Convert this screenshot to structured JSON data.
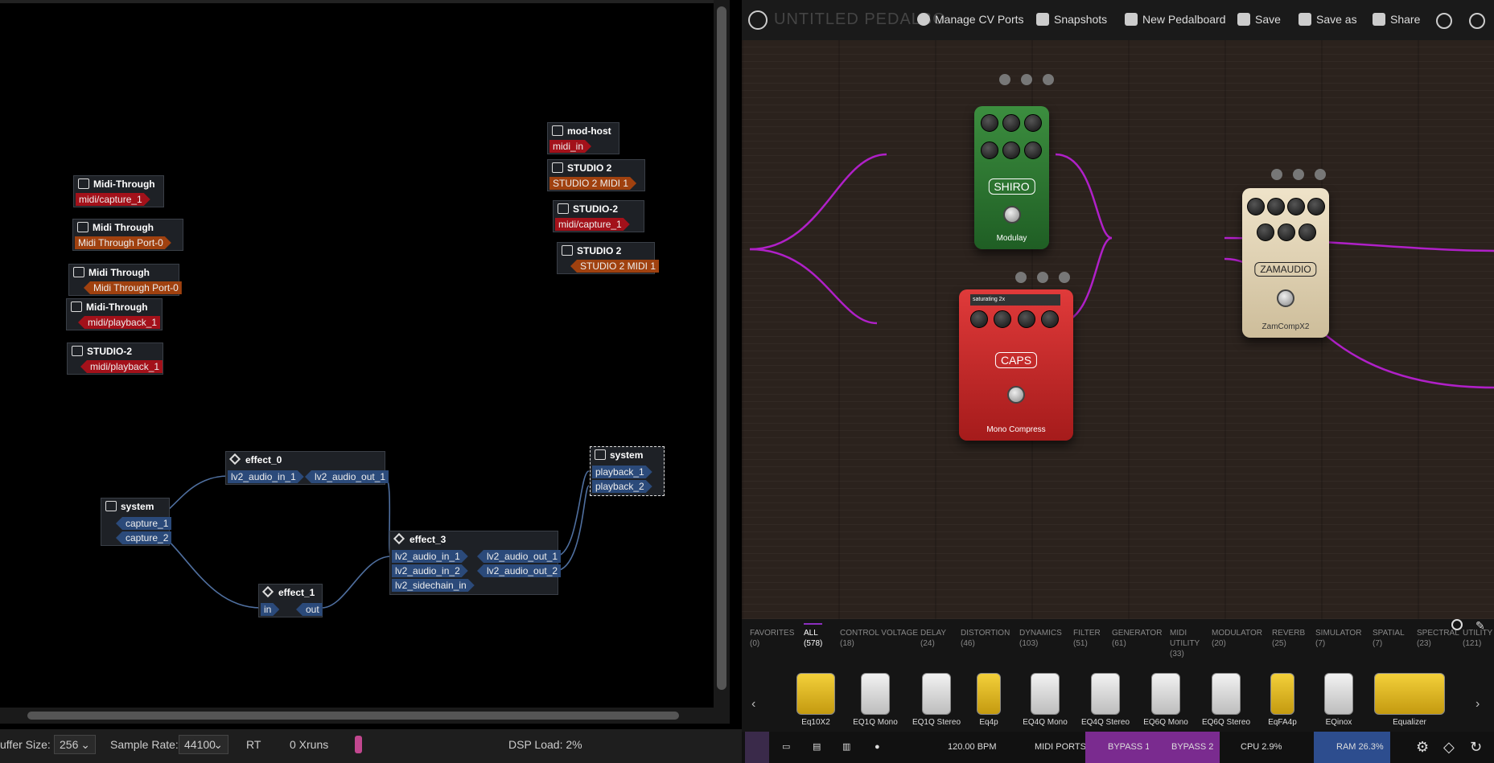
{
  "graph": {
    "nodes": {
      "midi_through_a": {
        "title": "Midi-Through",
        "ports": [
          "midi/capture_1"
        ]
      },
      "midi_through_b": {
        "title": "Midi Through",
        "ports": [
          "Midi Through Port-0"
        ]
      },
      "midi_through_c": {
        "title": "Midi Through",
        "ports": [
          "Midi Through Port-0"
        ]
      },
      "midi_through_d": {
        "title": "Midi-Through",
        "ports": [
          "midi/playback_1"
        ]
      },
      "studio2_a": {
        "title": "STUDIO-2",
        "ports": [
          "midi/playback_1"
        ]
      },
      "mod_host": {
        "title": "mod-host",
        "ports": [
          "midi_in"
        ]
      },
      "studio2_b": {
        "title": "STUDIO 2",
        "ports": [
          "STUDIO 2 MIDI 1"
        ]
      },
      "studio2_c": {
        "title": "STUDIO-2",
        "ports": [
          "midi/capture_1"
        ]
      },
      "studio2_d": {
        "title": "STUDIO 2",
        "ports": [
          "STUDIO 2 MIDI 1"
        ]
      },
      "system_capture": {
        "title": "system",
        "ports": [
          "capture_1",
          "capture_2"
        ]
      },
      "effect_0": {
        "title": "effect_0",
        "ports": [
          "lv2_audio_in_1",
          "lv2_audio_out_1"
        ]
      },
      "effect_1": {
        "title": "effect_1",
        "ports": [
          "in",
          "out"
        ]
      },
      "effect_3": {
        "title": "effect_3",
        "ports": [
          "lv2_audio_in_1",
          "lv2_audio_out_1",
          "lv2_audio_in_2",
          "lv2_audio_out_2",
          "lv2_sidechain_in"
        ]
      },
      "system_playback": {
        "title": "system",
        "ports": [
          "playback_1",
          "playback_2"
        ]
      }
    }
  },
  "statusbar": {
    "buffer_label": "uffer Size:",
    "buffer_value": "256",
    "rate_label": "Sample Rate:",
    "rate_value": "44100",
    "rt": "RT",
    "xruns": "0 Xruns",
    "dsp": "DSP Load: 2%"
  },
  "topbar": {
    "title": "UNTITLED PEDALBO",
    "manage_cv": "Manage CV Ports",
    "snapshots": "Snapshots",
    "new_pedalboard": "New Pedalboard",
    "save": "Save",
    "save_as": "Save as",
    "share": "Share"
  },
  "pedals": {
    "shiro": {
      "brand": "SHIRO",
      "name": "Modulay"
    },
    "caps": {
      "brand": "CAPS",
      "name": "Mono Compress",
      "display": "saturating 2x"
    },
    "zam": {
      "brand": "ZAMAUDIO",
      "name": "ZamCompX2"
    }
  },
  "categories": [
    {
      "label": "FAVORITES",
      "count": "(0)"
    },
    {
      "label": "ALL",
      "count": "(578)"
    },
    {
      "label": "CONTROL VOLTAGE",
      "count": "(18)"
    },
    {
      "label": "DELAY",
      "count": "(24)"
    },
    {
      "label": "DISTORTION",
      "count": "(46)"
    },
    {
      "label": "DYNAMICS",
      "count": "(103)"
    },
    {
      "label": "FILTER",
      "count": "(51)"
    },
    {
      "label": "GENERATOR",
      "count": "(61)"
    },
    {
      "label": "MIDI UTILITY",
      "count": "(33)"
    },
    {
      "label": "MODULATOR",
      "count": "(20)"
    },
    {
      "label": "REVERB",
      "count": "(25)"
    },
    {
      "label": "SIMULATOR",
      "count": "(7)"
    },
    {
      "label": "SPATIAL",
      "count": "(7)"
    },
    {
      "label": "SPECTRAL",
      "count": "(23)"
    },
    {
      "label": "UTILITY",
      "count": "(121)"
    }
  ],
  "plugins": [
    "Eq10X2",
    "EQ1Q Mono",
    "EQ1Q Stereo",
    "Eq4p",
    "EQ4Q Mono",
    "EQ4Q Stereo",
    "EQ6Q Mono",
    "EQ6Q Stereo",
    "EqFA4p",
    "EQinox",
    "Equalizer"
  ],
  "bottombar": {
    "bpm": "120.00 BPM",
    "midi_ports": "MIDI PORTS",
    "bypass1": "BYPASS 1",
    "bypass2": "BYPASS 2",
    "cpu": "CPU 2.9%",
    "ram": "RAM 26.3%"
  },
  "colors": {
    "midi": "#a3111a",
    "alias": "#a0410f",
    "audio": "#2b4a7a",
    "cable": "#b020c8",
    "bypass": "#7a2b8f"
  }
}
